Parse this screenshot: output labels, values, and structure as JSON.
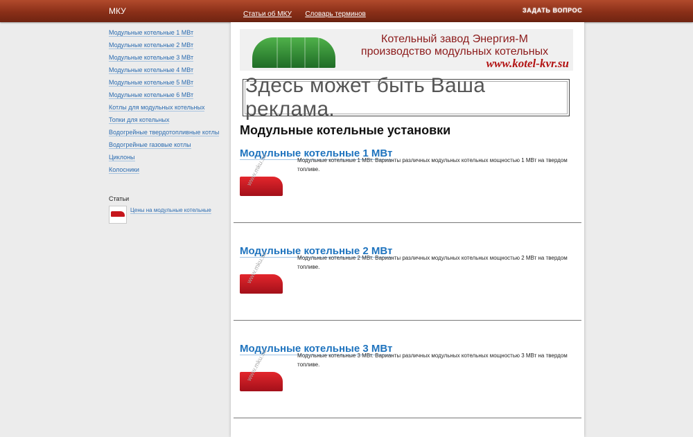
{
  "header": {
    "brand": "МКУ",
    "nav": [
      "Статьи об МКУ",
      "Словарь терминов"
    ],
    "ask_button": "ЗАДАТЬ ВОПРОС"
  },
  "sidebar": {
    "links": [
      "Модульные котельные 1 МВт",
      "Модульные котельные 2 МВт",
      "Модульные котельные 3 МВт",
      "Модульные котельные 4 МВт",
      "Модульные котельные 5 МВт",
      "Модульные котельные 6 МВт",
      "Котлы для модульных котельных",
      "Топки для котельных",
      "Водогрейные твердотопливные котлы",
      "Водогрейные газовые котлы",
      "Циклоны",
      "Колосники"
    ],
    "articles_title": "Статьи",
    "article_link": "Цены на модульные котельные"
  },
  "banner1": {
    "line1": "Котельный завод Энергия-М",
    "line2": "производство модульных котельных",
    "url": "www.kotel-kvr.su"
  },
  "banner2": {
    "text": "Здесь может быть Ваша реклама."
  },
  "main": {
    "title": "Модульные котельные установки",
    "watermark": "www.mku.su",
    "items": [
      {
        "title": "Модульные котельные 1 МВт",
        "text": "Модульные котельные 1 МВт. Варианты различных модульных котельных мощностью 1 МВт на твердом топливе."
      },
      {
        "title": "Модульные котельные 2 МВт",
        "text": "Модульные котельные 2 МВт. Варианты различных модульных котельных мощностью 2 МВт на твердом топливе."
      },
      {
        "title": "Модульные котельные 3 МВт",
        "text": "Модульные котельные 3 МВт. Варианты различных модульных котельных мощностью 3 МВт на твердом топливе."
      }
    ]
  }
}
